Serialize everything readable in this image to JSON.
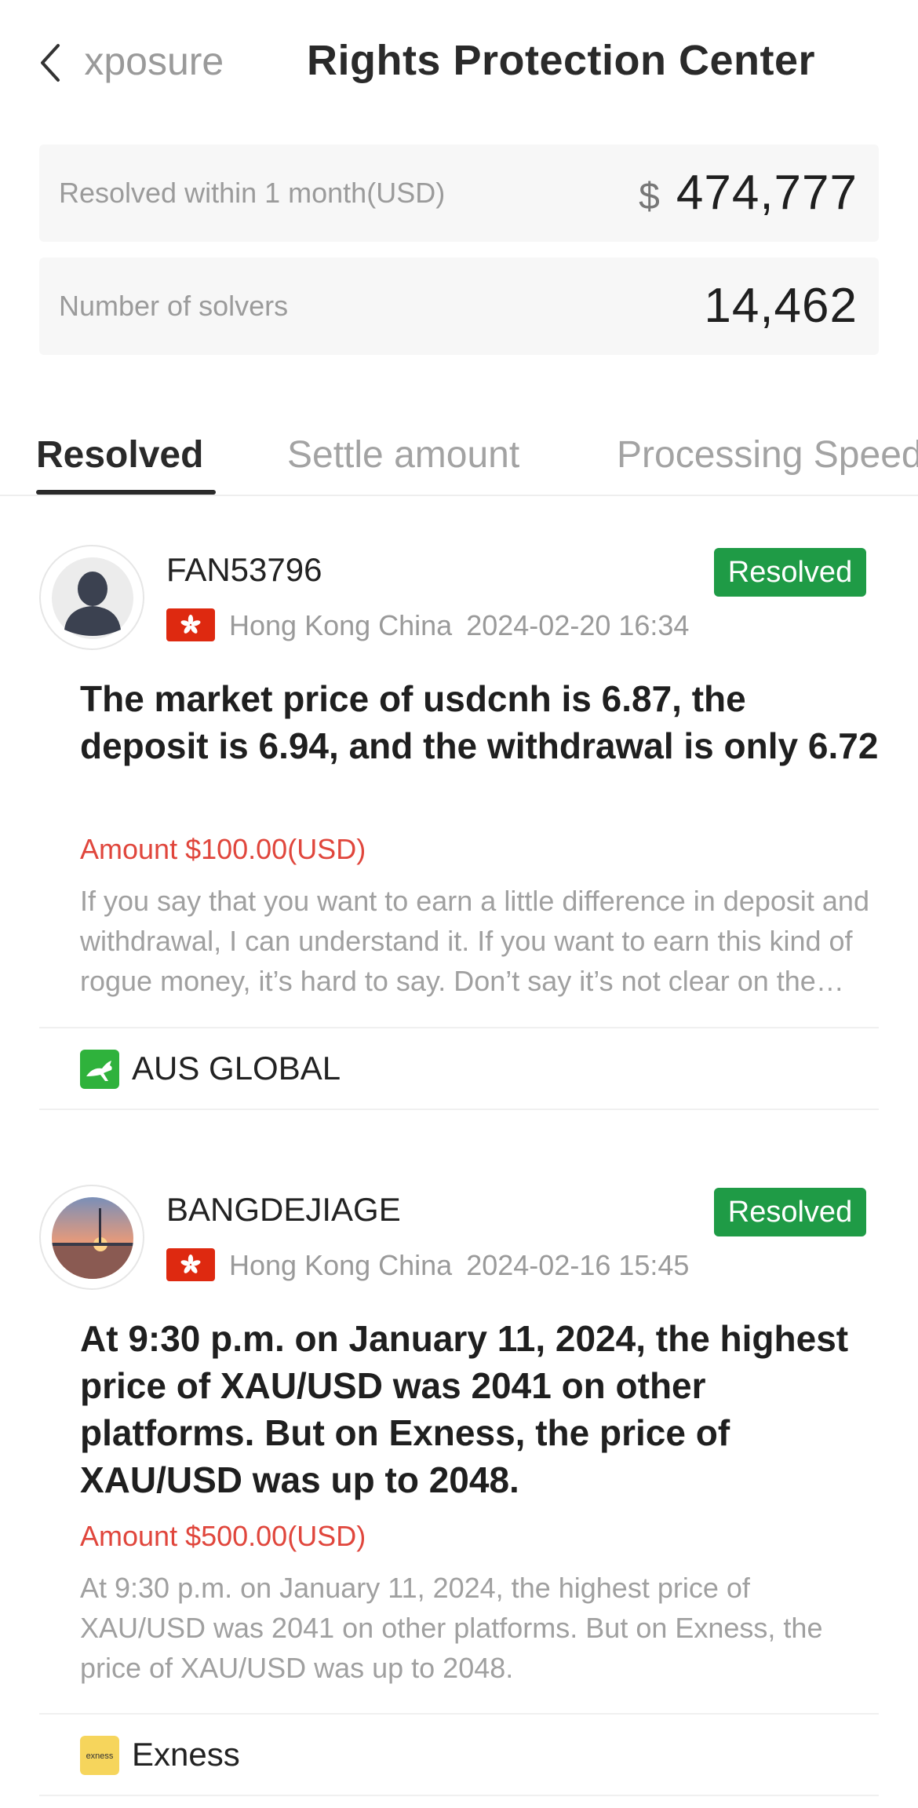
{
  "header": {
    "back_label": "Exposure",
    "title": "Rights Protection Center"
  },
  "stats": {
    "resolved_label": "Resolved within 1 month(USD)",
    "resolved_currency": "$",
    "resolved_value": "474,777",
    "solvers_label": "Number of solvers",
    "solvers_value": "14,462"
  },
  "tabs": [
    {
      "label": "Resolved",
      "active": true
    },
    {
      "label": "Settle amount",
      "active": false
    },
    {
      "label": "Processing Speed",
      "active": false
    }
  ],
  "complaints": [
    {
      "user": "FAN53796",
      "avatar": "default-person-icon",
      "status": "Resolved",
      "region": "Hong Kong China",
      "date": "2024-02-20 16:34",
      "title": "The market price of usdcnh is 6.87, the deposit is 6.94, and the withdrawal is only 6.72",
      "amount": "Amount $100.00(USD)",
      "description": "If you say that you want to earn a little difference in deposit and withdrawal, I can understand it. If you want to earn this kind of rogue money, it’s hard to say. Don’t say it’s not clear on the website, so don’t play with it.",
      "broker": "AUS GLOBAL",
      "broker_logo": "kangaroo-logo"
    },
    {
      "user": "BANGDEJIAGE",
      "avatar": "sunset-photo",
      "status": "Resolved",
      "region": "Hong Kong China",
      "date": "2024-02-16 15:45",
      "title": "At 9:30 p.m. on January 11, 2024, the highest price of XAU/USD was 2041 on other platforms. But on Exness, the price of XAU/USD was up to 2048.",
      "amount": "Amount $500.00(USD)",
      "description": "At 9:30 p.m. on January 11, 2024, the highest price of XAU/USD was 2041 on other platforms. But on Exness, the price of XAU/USD was up to 2048.",
      "broker": "Exness",
      "broker_logo": "exness-logo"
    }
  ],
  "colors": {
    "resolved_badge": "#1f9b46",
    "amount_red": "#e0463c",
    "flag_red": "#de2910"
  }
}
